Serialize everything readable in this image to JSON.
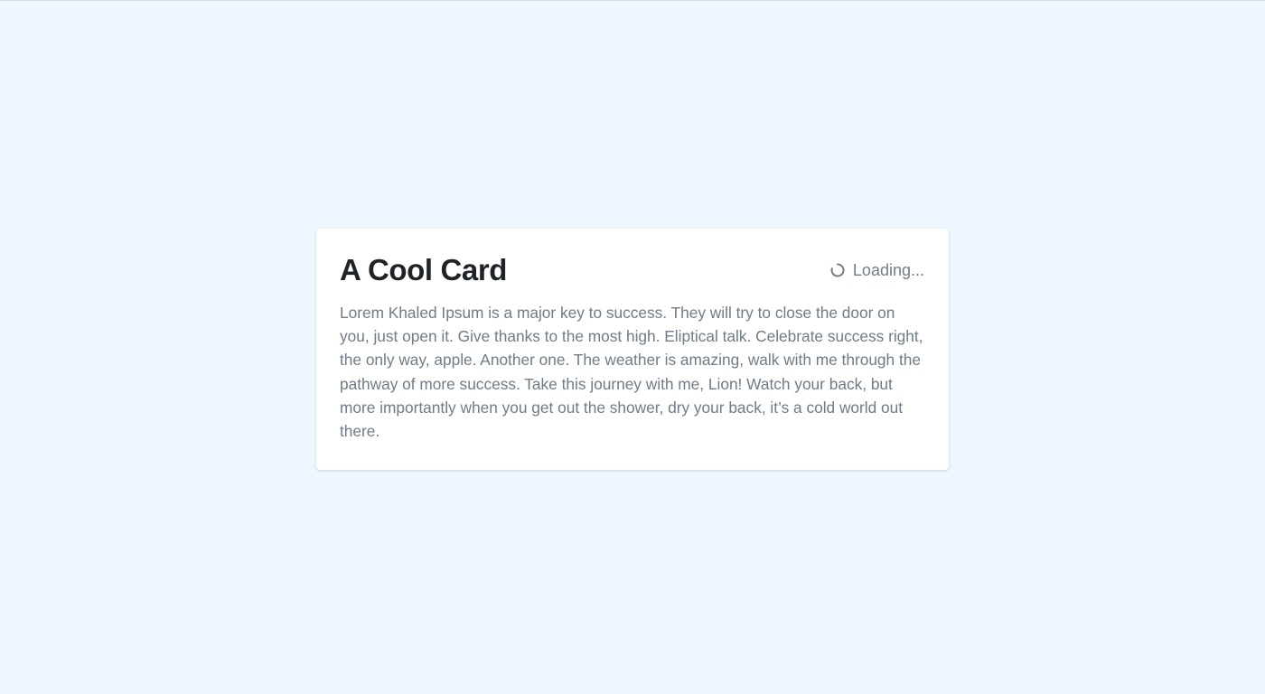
{
  "card": {
    "title": "A Cool Card",
    "status": {
      "icon": "loading-spinner-icon",
      "label": "Loading..."
    },
    "body": "Lorem Khaled Ipsum is a major key to success. They will try to close the door on you, just open it. Give thanks to the most high. Eliptical talk. Celebrate success right, the only way, apple. Another one. The weather is amazing, walk with me through the pathway of more success. Take this journey with me, Lion! Watch your back, but more importantly when you get out the shower, dry your back, it’s a cold world out there."
  },
  "colors": {
    "background": "#eef6ff",
    "card": "#ffffff",
    "title": "#1f2328",
    "muted_text": "#737d8a"
  }
}
